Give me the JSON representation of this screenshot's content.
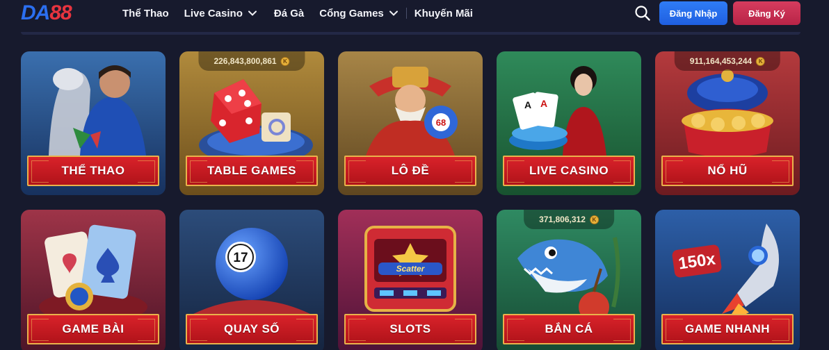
{
  "header": {
    "logo": {
      "part1": "DA",
      "part2": "88"
    },
    "nav": [
      {
        "label": "Thể Thao",
        "dropdown": false
      },
      {
        "label": "Live Casino",
        "dropdown": true
      },
      {
        "label": "Đá Gà",
        "dropdown": false
      },
      {
        "label": "Cổng Games",
        "dropdown": true
      },
      {
        "label": "Khuyến Mãi",
        "dropdown": false
      }
    ],
    "login_label": "Đăng Nhập",
    "register_label": "Đăng Ký",
    "search_icon": "search-icon"
  },
  "games": [
    {
      "label": "THỂ THAO",
      "jackpot": null,
      "theme": "sports"
    },
    {
      "label": "TABLE GAMES",
      "jackpot": "226,843,800,861",
      "theme": "table"
    },
    {
      "label": "LÔ ĐỀ",
      "jackpot": null,
      "theme": "lode"
    },
    {
      "label": "LIVE CASINO",
      "jackpot": null,
      "theme": "live"
    },
    {
      "label": "NỔ HŨ",
      "jackpot": "911,164,453,244",
      "theme": "nohu"
    },
    {
      "label": "GAME BÀI",
      "jackpot": null,
      "theme": "cards"
    },
    {
      "label": "QUAY SỐ",
      "jackpot": null,
      "theme": "lottery"
    },
    {
      "label": "SLOTS",
      "jackpot": null,
      "theme": "slots"
    },
    {
      "label": "BẮN CÁ",
      "jackpot": "371,806,312",
      "theme": "fish"
    },
    {
      "label": "GAME NHANH",
      "jackpot": null,
      "theme": "fast"
    }
  ],
  "art_text": {
    "lode_ball": "68",
    "lottery_ball": "17",
    "slots_sign": "Scatter",
    "fast_multiplier": "150x"
  },
  "coin_symbol": "K",
  "colors": {
    "background": "#171a2d",
    "login": "#2f7cf6",
    "register": "#d63c5e",
    "label_red": "#c81b22",
    "label_border": "#e9b24b"
  }
}
